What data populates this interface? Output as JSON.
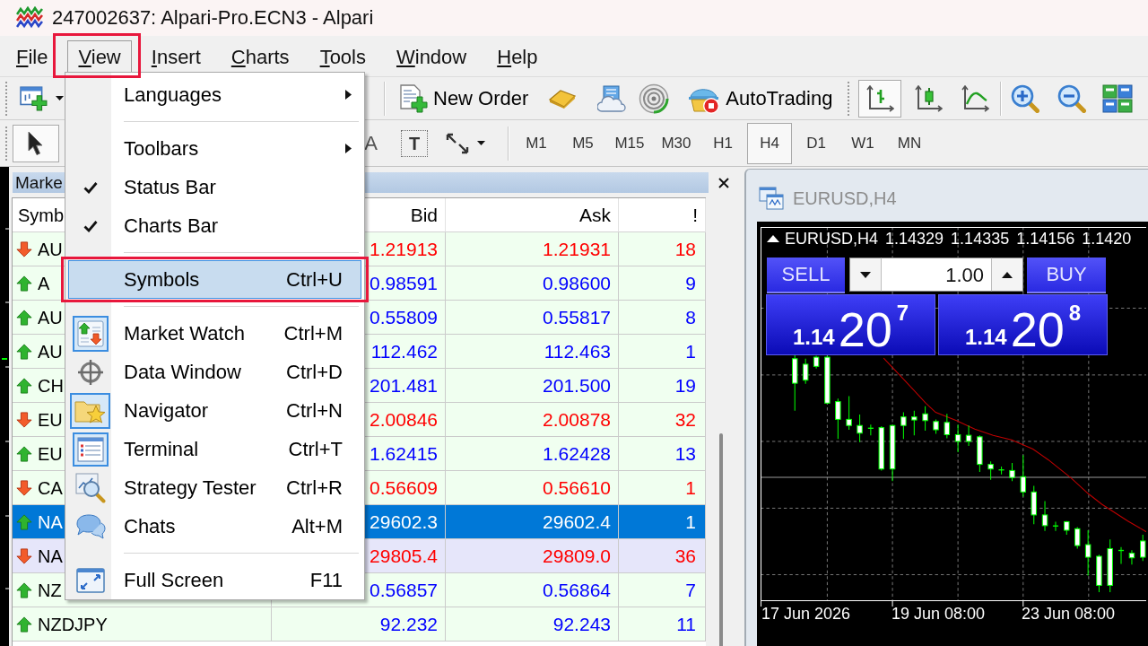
{
  "window": {
    "title": "247002637: Alpari-Pro.ECN3 - Alpari"
  },
  "menu_bar": [
    {
      "label": "File",
      "open": false,
      "annotated": false
    },
    {
      "label": "View",
      "open": true,
      "annotated": true
    },
    {
      "label": "Insert",
      "open": false,
      "annotated": false
    },
    {
      "label": "Charts",
      "open": false,
      "annotated": false
    },
    {
      "label": "Tools",
      "open": false,
      "annotated": false
    },
    {
      "label": "Window",
      "open": false,
      "annotated": false
    },
    {
      "label": "Help",
      "open": false,
      "annotated": false
    }
  ],
  "toolbar": {
    "new_order": "New Order",
    "auto_trading": "AutoTrading",
    "chart_types": [
      {
        "kind": "bars",
        "selected": true
      },
      {
        "kind": "candles",
        "selected": false
      },
      {
        "kind": "line",
        "selected": false
      }
    ]
  },
  "drawing_tools": [
    {
      "kind": "cursor",
      "selected": true
    },
    {
      "kind": "text",
      "glyph": "A",
      "selected": false
    },
    {
      "kind": "label",
      "glyph": "T",
      "selected": false
    },
    {
      "kind": "arrows",
      "selected": false
    }
  ],
  "timeframes": [
    {
      "label": "M1",
      "selected": false
    },
    {
      "label": "M5",
      "selected": false
    },
    {
      "label": "M15",
      "selected": false
    },
    {
      "label": "M30",
      "selected": false
    },
    {
      "label": "H1",
      "selected": false
    },
    {
      "label": "H4",
      "selected": true
    },
    {
      "label": "D1",
      "selected": false
    },
    {
      "label": "W1",
      "selected": false
    },
    {
      "label": "MN",
      "selected": false
    }
  ],
  "view_menu": {
    "items": [
      {
        "kind": "submenu",
        "label": "Languages",
        "selected": false,
        "annotated": false
      },
      {
        "kind": "separator"
      },
      {
        "kind": "submenu",
        "label": "Toolbars",
        "selected": false,
        "annotated": false
      },
      {
        "kind": "toggle",
        "label": "Status Bar",
        "checked": true,
        "selected": false,
        "annotated": false
      },
      {
        "kind": "toggle",
        "label": "Charts Bar",
        "checked": true,
        "selected": false,
        "annotated": false
      },
      {
        "kind": "separator"
      },
      {
        "kind": "item",
        "label": "Symbols",
        "shortcut": "Ctrl+U",
        "selected": true,
        "annotated": true
      },
      {
        "kind": "separator"
      },
      {
        "kind": "panel",
        "label": "Market Watch",
        "shortcut": "Ctrl+M",
        "checked": true,
        "selected": false,
        "annotated": false
      },
      {
        "kind": "panel",
        "label": "Data Window",
        "shortcut": "Ctrl+D",
        "checked": false,
        "selected": false,
        "annotated": false
      },
      {
        "kind": "panel",
        "label": "Navigator",
        "shortcut": "Ctrl+N",
        "checked": true,
        "selected": false,
        "annotated": false
      },
      {
        "kind": "panel",
        "label": "Terminal",
        "shortcut": "Ctrl+T",
        "checked": true,
        "selected": false,
        "annotated": false
      },
      {
        "kind": "panel",
        "label": "Strategy Tester",
        "shortcut": "Ctrl+R",
        "checked": false,
        "selected": false,
        "annotated": false
      },
      {
        "kind": "panel",
        "label": "Chats",
        "shortcut": "Alt+M",
        "checked": false,
        "selected": false,
        "annotated": false
      },
      {
        "kind": "separator"
      },
      {
        "kind": "panel",
        "label": "Full Screen",
        "shortcut": "F11",
        "checked": false,
        "selected": false,
        "annotated": false
      }
    ]
  },
  "market_watch": {
    "title": "Marke",
    "columns": [
      "Symb",
      "Bid",
      "Ask",
      "!"
    ],
    "rows": [
      {
        "symbol": "AU",
        "kind": "down",
        "bid": "1.21913",
        "ask": "1.21931",
        "spread": "18",
        "selected": false,
        "hovered": false
      },
      {
        "symbol": "A",
        "kind": "up",
        "bid": "0.98591",
        "ask": "0.98600",
        "spread": "9",
        "selected": false,
        "hovered": false
      },
      {
        "symbol": "AU",
        "kind": "up",
        "bid": "0.55809",
        "ask": "0.55817",
        "spread": "8",
        "selected": false,
        "hovered": false
      },
      {
        "symbol": "AU",
        "kind": "up",
        "bid": "112.462",
        "ask": "112.463",
        "spread": "1",
        "selected": false,
        "hovered": false
      },
      {
        "symbol": "CH",
        "kind": "up",
        "bid": "201.481",
        "ask": "201.500",
        "spread": "19",
        "selected": false,
        "hovered": false
      },
      {
        "symbol": "EU",
        "kind": "down",
        "bid": "2.00846",
        "ask": "2.00878",
        "spread": "32",
        "selected": false,
        "hovered": false
      },
      {
        "symbol": "EU",
        "kind": "up",
        "bid": "1.62415",
        "ask": "1.62428",
        "spread": "13",
        "selected": false,
        "hovered": false
      },
      {
        "symbol": "CA",
        "kind": "down",
        "bid": "0.56609",
        "ask": "0.56610",
        "spread": "1",
        "selected": false,
        "hovered": false
      },
      {
        "symbol": "NA",
        "kind": "up",
        "bid": "29602.3",
        "ask": "29602.4",
        "spread": "1",
        "selected": true,
        "hovered": false
      },
      {
        "symbol": "NA",
        "kind": "down",
        "bid": "29805.4",
        "ask": "29809.0",
        "spread": "36",
        "selected": false,
        "hovered": true
      },
      {
        "symbol": "NZ",
        "kind": "up",
        "bid": "0.56857",
        "ask": "0.56864",
        "spread": "7",
        "selected": false,
        "hovered": false
      },
      {
        "symbol": "NZDJPY",
        "kind": "up",
        "bid": "92.232",
        "ask": "92.243",
        "spread": "11",
        "selected": false,
        "hovered": false
      }
    ]
  },
  "chart_window": {
    "title": "EURUSD,H4",
    "info": {
      "symbol": "EURUSD,H4",
      "prices": [
        "1.14329",
        "1.14335",
        "1.14156",
        "1.1420"
      ]
    },
    "trade_panel": {
      "sell_label": "SELL",
      "buy_label": "BUY",
      "lot": "1.00",
      "sell_price": {
        "figure": "1.14",
        "pips": "20",
        "point": "7"
      },
      "buy_price": {
        "figure": "1.14",
        "pips": "20",
        "point": "8"
      }
    },
    "time_labels": [
      "17 Jun 2026",
      "19 Jun 08:00",
      "23 Jun 08:00"
    ]
  }
}
